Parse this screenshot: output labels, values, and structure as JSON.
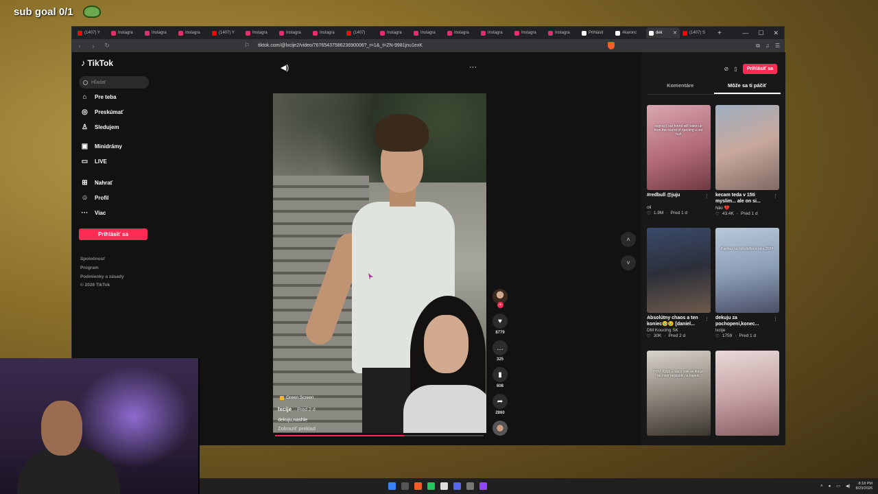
{
  "stream": {
    "title": "sub goal 0/1"
  },
  "browser": {
    "tabs": [
      {
        "label": "(1407) Y",
        "color": "#ff0000"
      },
      {
        "label": "Instagra",
        "color": "#e1306c"
      },
      {
        "label": "Instagra",
        "color": "#e1306c"
      },
      {
        "label": "Instagra",
        "color": "#e1306c"
      },
      {
        "label": "(1407) Y",
        "color": "#ff0000"
      },
      {
        "label": "Instagra",
        "color": "#e1306c"
      },
      {
        "label": "Instagra",
        "color": "#e1306c"
      },
      {
        "label": "Instagra",
        "color": "#e1306c"
      },
      {
        "label": "(1407)",
        "color": "#ff0000"
      },
      {
        "label": "Instagra",
        "color": "#e1306c"
      },
      {
        "label": "Instagra",
        "color": "#e1306c"
      },
      {
        "label": "Instagra",
        "color": "#e1306c"
      },
      {
        "label": "Instagra",
        "color": "#e1306c"
      },
      {
        "label": "Instagra",
        "color": "#e1306c"
      },
      {
        "label": "Instagra",
        "color": "#e1306c"
      },
      {
        "label": "Prihlásit",
        "color": "#ffffff"
      },
      {
        "label": "#karonc",
        "color": "#ffffff"
      },
      {
        "label": "dek",
        "color": "#ffffff",
        "active": true
      },
      {
        "label": "(1407) S",
        "color": "#ff0000"
      }
    ],
    "url": "tiktok.com/@lxcije2/video/7676543758623690006?_r=1&_t=ZN-9981jnu1exK"
  },
  "tiktok": {
    "logo": "TikTok",
    "search_placeholder": "Hľadať",
    "nav": [
      {
        "label": "Pre teba",
        "icon": "home-icon",
        "glyph": "⌂"
      },
      {
        "label": "Preskúmať",
        "icon": "compass-icon",
        "glyph": "◎"
      },
      {
        "label": "Sledujem",
        "icon": "following-icon",
        "glyph": "♙"
      },
      {
        "label": "Minidrámy",
        "icon": "minidrama-icon",
        "glyph": "▣"
      },
      {
        "label": "LIVE",
        "icon": "live-icon",
        "glyph": "▭"
      },
      {
        "label": "Nahrať",
        "icon": "upload-icon",
        "glyph": "⊞"
      },
      {
        "label": "Profil",
        "icon": "profile-icon",
        "glyph": "☺"
      },
      {
        "label": "Viac",
        "icon": "more-icon",
        "glyph": "···"
      }
    ],
    "login_label": "Prihlásiť sa",
    "footer": [
      "Spoločnosť",
      "Program",
      "Podmienky a zásady",
      "© 2026 TikTok"
    ],
    "video": {
      "effect": "Green Screen",
      "author": "lxcije",
      "time": "· Pred 2 d",
      "caption": "dekuju,nashle",
      "translate": "Zobraziť preklad",
      "progress": 0.62
    },
    "actions": {
      "likes": "8779",
      "comments": "325",
      "saves": "608",
      "shares": "2860"
    },
    "right_panel": {
      "login_label": "Prihlásiť sa",
      "tabs": [
        "Komentáre",
        "Môže sa ti páčiť"
      ],
      "active_tab": 1,
      "cards": [
        {
          "title": "#redbull @juju",
          "user": "oli",
          "likes": "1.9M",
          "time": "Pred 1 d",
          "overlay": "saying if our friend will wake up from the sound of opening a red bull",
          "bg": "linear-gradient(160deg,#d9a7b0,#b36a7a 55%,#6e3a44)"
        },
        {
          "title": "kecam teda v 15ti myslim... ale on si...",
          "user": "Niki 💔",
          "likes": "43.4K",
          "time": "Pred 1 d",
          "overlay": "",
          "bg": "linear-gradient(160deg,#9fb0c2,#c8a79b 50%,#7f6a64)"
        },
        {
          "title": "Absolútny chaos a ten koniec🥹😢 [daniel...",
          "user": "DM Koucing SK",
          "likes": "30K",
          "time": "Pred 2 d",
          "overlay": "",
          "bg": "linear-gradient(170deg,#3a4a6a,#2c2f3a 50%,#6d5a4c)"
        },
        {
          "title": "dekuju za pochopeni,konec...",
          "user": "lxcije",
          "likes": "1759",
          "time": "Pred 1 d",
          "overlay": "Pavlous na mikuláškom roku 2024",
          "bg": "linear-gradient(170deg,#b9c7d8,#8c9fb8 50%,#4a4f66)"
        },
        {
          "title": "",
          "user": "",
          "likes": "",
          "time": "",
          "overlay": "POV: Když u nás v sále se klouzl bicmistr nejslabší na kapelu",
          "bg": "linear-gradient(170deg,#d9d4cc,#8c857a 50%,#3b3631)"
        },
        {
          "title": "",
          "user": "",
          "likes": "",
          "time": "",
          "overlay": "",
          "bg": "linear-gradient(170deg,#e8dad8,#c7a3a8 50%,#8a5f66)"
        }
      ]
    }
  },
  "taskbar": {
    "time": "8:18 PM",
    "date": "8/23/2026"
  }
}
